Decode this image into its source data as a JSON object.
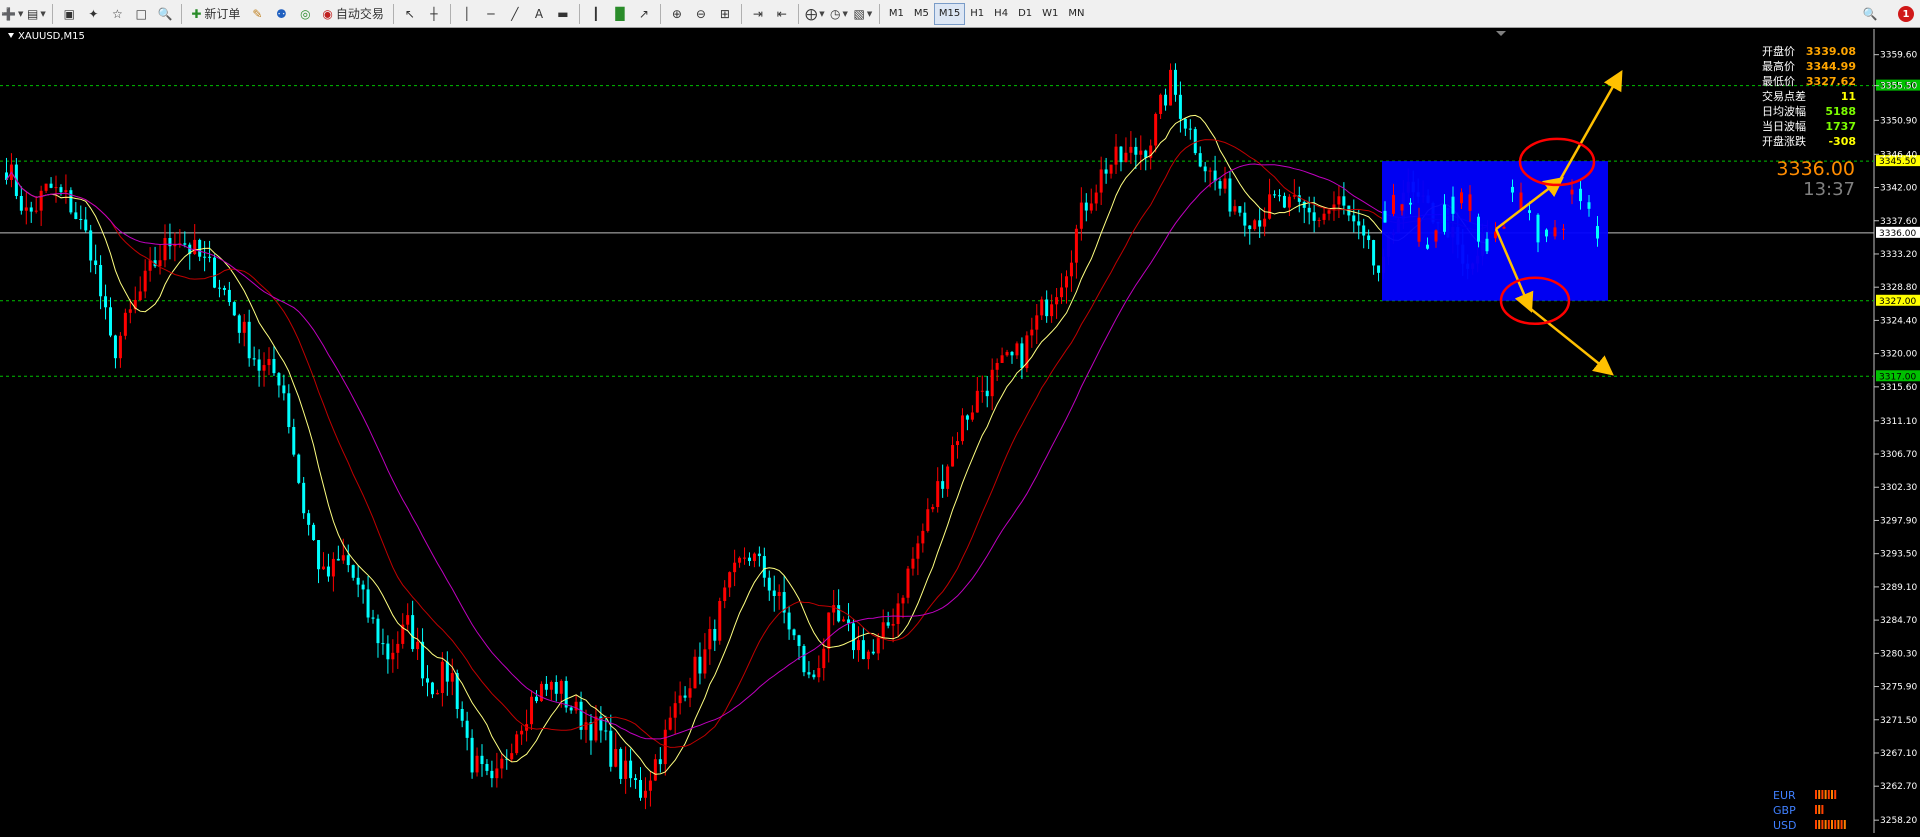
{
  "toolbar": {
    "new_order_label": "新订单",
    "auto_trade_label": "自动交易",
    "timeframes": [
      "M1",
      "M5",
      "M15",
      "H1",
      "H4",
      "D1",
      "W1",
      "MN"
    ],
    "selected_timeframe": "M15",
    "notification_count": "1",
    "icons": [
      "new-chart-icon",
      "profiles-icon",
      "market-watch-icon",
      "navigator-icon",
      "favorites-icon",
      "terminal-icon",
      "tester-icon",
      "new-order-icon",
      "pencil-icon",
      "signals-icon",
      "globe-icon",
      "auto-trade-icon",
      "cursor-icon",
      "crosshair-icon",
      "vertical-line-icon",
      "horizontal-line-icon",
      "trendline-icon",
      "text-icon",
      "label-icon",
      "bar-chart-icon",
      "candle-chart-icon",
      "line-chart-icon",
      "zoom-in-icon",
      "zoom-out-icon",
      "tile-icon",
      "auto-scroll-icon",
      "chart-shift-icon",
      "indicators-icon",
      "periods-icon",
      "templates-icon",
      "search-icon"
    ]
  },
  "chart": {
    "symbol_label": "XAUUSD,M15",
    "info_panel": [
      {
        "label": "开盘价",
        "value": "3339.08",
        "color": "#ffa500"
      },
      {
        "label": "最高价",
        "value": "3344.99",
        "color": "#ffa500"
      },
      {
        "label": "最低价",
        "value": "3327.62",
        "color": "#ffa500"
      },
      {
        "label": "交易点差",
        "value": "11",
        "color": "#ffff00"
      },
      {
        "label": "日均波幅",
        "value": "5188",
        "color": "#7cfc00"
      },
      {
        "label": "当日波幅",
        "value": "1737",
        "color": "#7cfc00"
      },
      {
        "label": "开盘涨跌",
        "value": "-308",
        "color": "#ffff00"
      }
    ],
    "current_price": "3336.00",
    "countdown": "13:37",
    "price_levels": [
      {
        "value": "3355.50",
        "color": "#00c000"
      },
      {
        "value": "3345.50",
        "color": "#ffff00"
      },
      {
        "value": "3336.00",
        "color": "#ffffff"
      },
      {
        "value": "3327.00",
        "color": "#ffff00"
      },
      {
        "value": "3317.00",
        "color": "#00c000"
      }
    ],
    "axis_ticks": [
      "3359.60",
      "3355.50",
      "3350.90",
      "3346.40",
      "3342.00",
      "3337.60",
      "3333.20",
      "3328.80",
      "3324.40",
      "3320.00",
      "3315.60",
      "3311.10",
      "3306.70",
      "3302.30",
      "3297.90",
      "3293.50",
      "3289.10",
      "3284.70",
      "3280.30",
      "3275.90",
      "3271.50",
      "3267.10",
      "3262.70",
      "3258.20"
    ],
    "currency_strength": [
      {
        "name": "EUR",
        "bars": 7
      },
      {
        "name": "GBP",
        "bars": 3
      },
      {
        "name": "USD",
        "bars": 10
      }
    ],
    "colors": {
      "bull": "#ff0000",
      "bear": "#00ffff",
      "ma_fast": "#ffff80",
      "ma_mid": "#c00000",
      "ma_slow": "#c000c0",
      "box": "#0000ff",
      "arrow": "#ffc000",
      "circle": "#ff0000",
      "grid_dash": "#00c000"
    }
  },
  "chart_data": {
    "type": "candlestick",
    "title": "XAUUSD,M15",
    "ylim": [
      3256.5,
      3363.0
    ],
    "key_close_path": [
      3345,
      3338,
      3342,
      3340,
      3334,
      3320,
      3326,
      3332,
      3336,
      3333,
      3330,
      3324,
      3318,
      3317,
      3300,
      3290,
      3293,
      3286,
      3280,
      3284,
      3276,
      3278,
      3266,
      3262,
      3270,
      3275,
      3276,
      3272,
      3270,
      3265,
      3262,
      3268,
      3276,
      3280,
      3288,
      3294,
      3290,
      3284,
      3276,
      3285,
      3282,
      3280,
      3286,
      3294,
      3302,
      3310,
      3315,
      3318,
      3320,
      3326,
      3331,
      3340,
      3345,
      3346,
      3348,
      3356,
      3349,
      3343,
      3340,
      3338,
      3340,
      3339,
      3338,
      3340,
      3335,
      3330,
      3342,
      3339,
      3338,
      3330,
      3336
    ]
  }
}
